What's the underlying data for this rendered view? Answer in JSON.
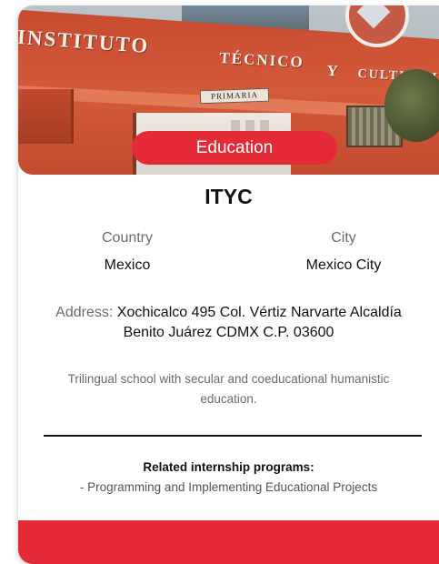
{
  "card": {
    "category": "Education",
    "title": "ITYC",
    "country": {
      "label": "Country",
      "value": "Mexico"
    },
    "city": {
      "label": "City",
      "value": "Mexico City"
    },
    "address": {
      "label": "Address:",
      "value": "Xochicalco 495 Col. Vértiz Narvarte Alcaldía Benito Juárez CDMX C.P. 03600"
    },
    "description": "Trilingual school with secular and coeducational humanistic education.",
    "related": {
      "heading": "Related internship programs:",
      "items": [
        "- Programming and Implementing Educational Projects"
      ]
    }
  },
  "photo": {
    "facade_text": [
      "INSTITUTO",
      "TÉCNICO",
      "Y",
      "CULTURAL"
    ],
    "sign_text": "PRIMARIA"
  },
  "colors": {
    "accent": "#e52a37",
    "muted_text": "#6b6b6b",
    "text": "#111111"
  }
}
